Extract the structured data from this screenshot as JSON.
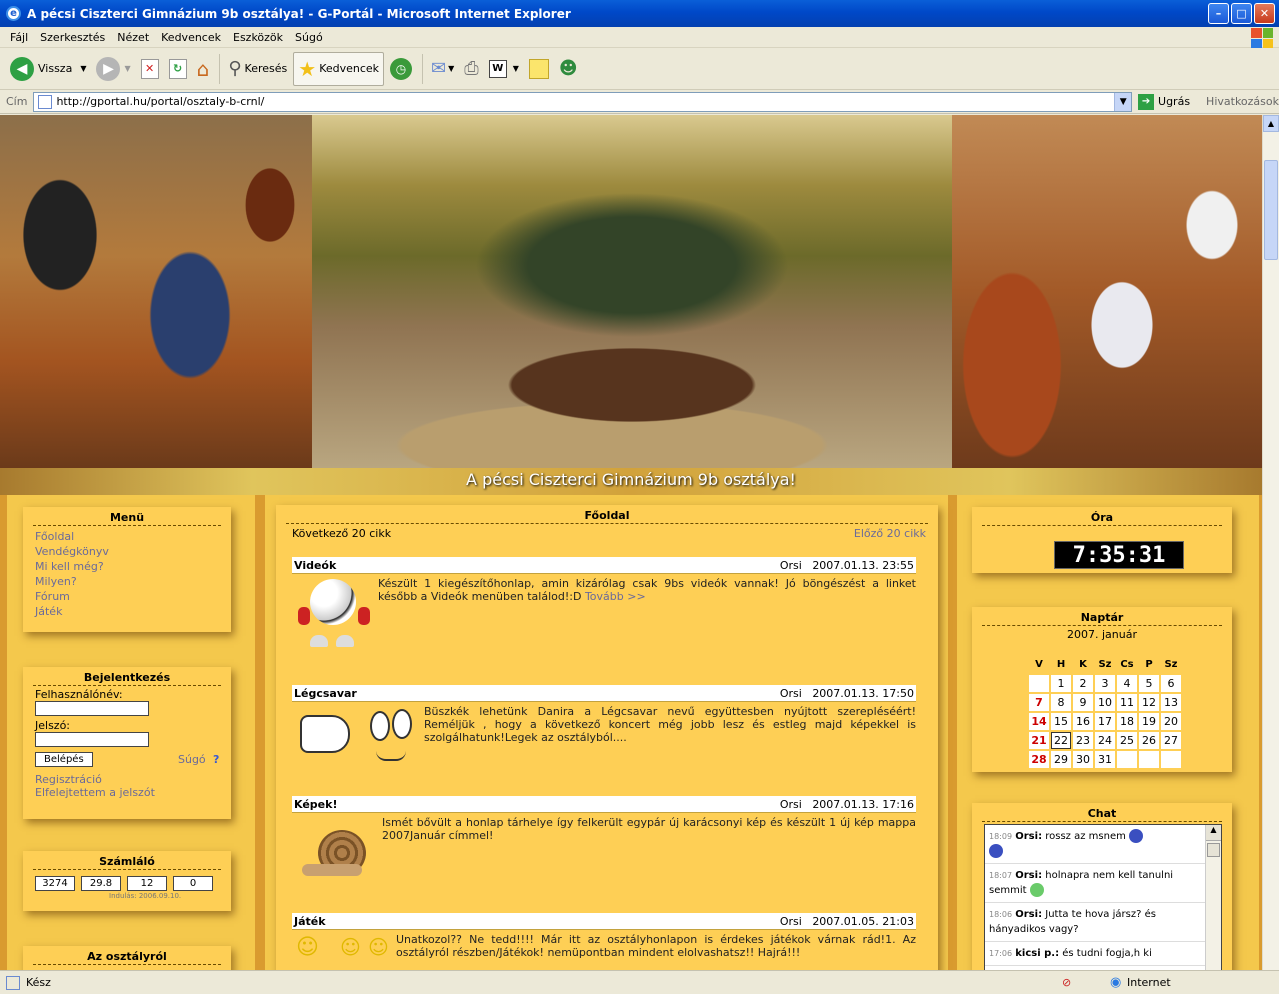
{
  "window": {
    "title": "A pécsi Ciszterci Gimnázium 9b osztálya! - G-Portál - Microsoft Internet Explorer"
  },
  "menubar": [
    "Fájl",
    "Szerkesztés",
    "Nézet",
    "Kedvencek",
    "Eszközök",
    "Súgó"
  ],
  "toolbar": {
    "back": "Vissza",
    "search": "Keresés",
    "favorites": "Kedvencek"
  },
  "address": {
    "label": "Cím",
    "url": "http://gportal.hu/portal/osztaly-b-crnl/",
    "go": "Ugrás",
    "links": "Hivatkozások"
  },
  "site": {
    "title": "A pécsi Ciszterci Gimnázium 9b osztálya!"
  },
  "menu": {
    "title": "Menü",
    "items": [
      "Főoldal",
      "Vendégkönyv",
      "Mi kell még?",
      "Milyen?",
      "Fórum",
      "Játék"
    ]
  },
  "login": {
    "title": "Bejelentkezés",
    "user_label": "Felhasználónév:",
    "pass_label": "Jelszó:",
    "submit": "Belépés",
    "help": "Súgó",
    "help_icon": "?",
    "register": "Regisztráció",
    "forgot": "Elfelejtettem a jelszót"
  },
  "counter": {
    "title": "Számláló",
    "values": [
      "3274",
      "29.8",
      "12",
      "0"
    ],
    "since": "Indulás: 2006.09.10."
  },
  "about": {
    "title": "Az osztályról"
  },
  "main": {
    "title": "Főoldal",
    "next": "Következő 20 cikk",
    "prev": "Előző 20 cikk",
    "articles": [
      {
        "title": "Videók",
        "author": "Orsi",
        "date": "2007.01.13. 23:55",
        "text": "Készült 1 kiegészítőhonlap, amin kizárólag csak 9bs videók vannak! Jó böngészést a linket később a Videók menüben találod!:D",
        "more": "Tovább >>"
      },
      {
        "title": "Légcsavar",
        "author": "Orsi",
        "date": "2007.01.13. 17:50",
        "text": "Büszkék lehetünk Danira a Légcsavar nevű együttesben nyújtott szerepléséért! Reméljük , hogy a következő koncert még jobb lesz és estleg majd képekkel is szolgálhatunk!Legek az osztályból...."
      },
      {
        "title": "Képek!",
        "author": "Orsi",
        "date": "2007.01.13. 17:16",
        "text": "Ismét bővült a honlap tárhelye így felkerült egypár új karácsonyi kép és készült 1 új kép mappa 2007Január címmel!"
      },
      {
        "title": "Játék",
        "author": "Orsi",
        "date": "2007.01.05. 21:03",
        "text": "Unatkozol?? Ne tedd!!!! Már itt az osztályhonlapon is érdekes játékok várnak rád!1. Az osztályról részben/Játékok! nemüpontban mindent elolvashatsz!! Hajrá!!!"
      }
    ]
  },
  "clock": {
    "title": "Óra",
    "time": "7:35:31"
  },
  "calendar": {
    "title": "Naptár",
    "month": "2007. január",
    "weekdays": [
      "V",
      "H",
      "K",
      "Sz",
      "Cs",
      "P",
      "Sz"
    ],
    "weeks": [
      [
        "",
        "1",
        "2",
        "3",
        "4",
        "5",
        "6"
      ],
      [
        "7",
        "8",
        "9",
        "10",
        "11",
        "12",
        "13"
      ],
      [
        "14",
        "15",
        "16",
        "17",
        "18",
        "19",
        "20"
      ],
      [
        "21",
        "22",
        "23",
        "24",
        "25",
        "26",
        "27"
      ],
      [
        "28",
        "29",
        "30",
        "31",
        "",
        "",
        ""
      ]
    ],
    "today": "22"
  },
  "chat": {
    "title": "Chat",
    "messages": [
      {
        "time": "18:09",
        "user": "Orsi:",
        "text": "rossz az msnem"
      },
      {
        "time": "18:07",
        "user": "Orsi:",
        "text": "holnapra nem kell tanulni semmit"
      },
      {
        "time": "18:06",
        "user": "Orsi:",
        "text": "Jutta te hova jársz? és hányadikos vagy?"
      },
      {
        "time": "17:06",
        "user": "kicsi p.:",
        "text": "és tudni fogja,h ki"
      }
    ]
  },
  "status": {
    "left": "Kész",
    "zone": "Internet"
  }
}
